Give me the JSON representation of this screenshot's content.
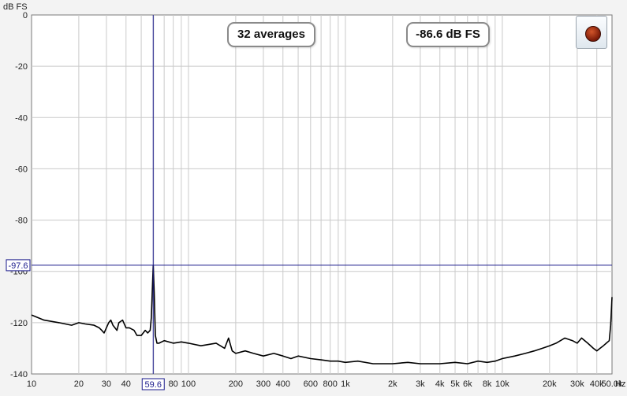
{
  "chart_data": {
    "type": "line",
    "ylabel": "dB FS",
    "xunit": "Hz",
    "xscale": "log",
    "xlim": [
      10,
      50000
    ],
    "ylim": [
      -140,
      0
    ],
    "grid": true,
    "yticks": [
      0,
      -20,
      -40,
      -60,
      -80,
      -100,
      -120,
      -140
    ],
    "ytick_labels": [
      "0",
      "-20",
      "-40",
      "-60",
      "-80",
      "-100",
      "-120",
      "-140"
    ],
    "xticks": [
      10,
      20,
      30,
      40,
      80,
      100,
      200,
      300,
      400,
      600,
      800,
      1000,
      2000,
      3000,
      4000,
      5000,
      6000,
      8000,
      10000,
      20000,
      30000,
      40000,
      50000
    ],
    "xtick_labels": [
      "10",
      "20",
      "30",
      "40",
      "80",
      "100",
      "200",
      "300",
      "400",
      "600",
      "800",
      "1k",
      "2k",
      "3k",
      "4k",
      "5k",
      "6k",
      "8k",
      "10k",
      "20k",
      "30k",
      "40k",
      "50.0k"
    ],
    "cursor": {
      "x": 59.6,
      "y": -97.6,
      "x_label": "59.6",
      "y_label": "-97.6"
    },
    "series": [
      {
        "color": "#000000",
        "x": [
          10,
          12,
          15,
          18,
          20,
          22,
          25,
          27,
          28,
          29,
          30,
          31,
          32,
          33,
          35,
          36,
          38,
          40,
          42,
          45,
          47,
          50,
          53,
          55,
          57,
          58,
          59,
          59.6,
          60.5,
          61.5,
          63,
          65,
          70,
          80,
          90,
          100,
          120,
          150,
          170,
          180,
          190,
          200,
          230,
          260,
          300,
          350,
          400,
          450,
          500,
          600,
          700,
          800,
          900,
          1000,
          1200,
          1500,
          2000,
          2500,
          3000,
          4000,
          5000,
          6000,
          7000,
          8000,
          9000,
          10000,
          12000,
          14000,
          16000,
          18000,
          20000,
          22000,
          25000,
          28000,
          30000,
          32000,
          35000,
          38000,
          40000,
          42000,
          44000,
          46000,
          48000,
          49000,
          50000
        ],
        "y": [
          -117,
          -119,
          -120,
          -121,
          -120,
          -120.5,
          -121,
          -122,
          -123,
          -124,
          -122,
          -120,
          -119,
          -121,
          -123,
          -120,
          -119,
          -122,
          -122,
          -123,
          -125,
          -125,
          -123,
          -124,
          -123,
          -118,
          -105,
          -97.6,
          -108,
          -125,
          -128,
          -128,
          -127,
          -128,
          -127.5,
          -128,
          -129,
          -128,
          -130,
          -126,
          -131,
          -132,
          -131,
          -132,
          -133,
          -132,
          -133,
          -134,
          -133,
          -134,
          -134.5,
          -135,
          -135,
          -135.5,
          -135,
          -136,
          -136,
          -135.5,
          -136,
          -136,
          -135.5,
          -136,
          -135,
          -135.5,
          -135,
          -134,
          -133,
          -132,
          -131,
          -130,
          -129,
          -128,
          -126,
          -127,
          -128,
          -126,
          -128,
          -130,
          -131,
          -130,
          -129,
          -128,
          -127,
          -121,
          -110
        ]
      }
    ]
  },
  "overlay": {
    "averages": "32 averages",
    "level": "-86.6 dB FS"
  },
  "colors": {
    "background": "#f3f3f3",
    "plot_bg": "#ffffff",
    "grid": "#cacaca",
    "cursor": "#1a1a8c",
    "trace": "#000000"
  },
  "record_button": {
    "icon": "record-icon"
  }
}
